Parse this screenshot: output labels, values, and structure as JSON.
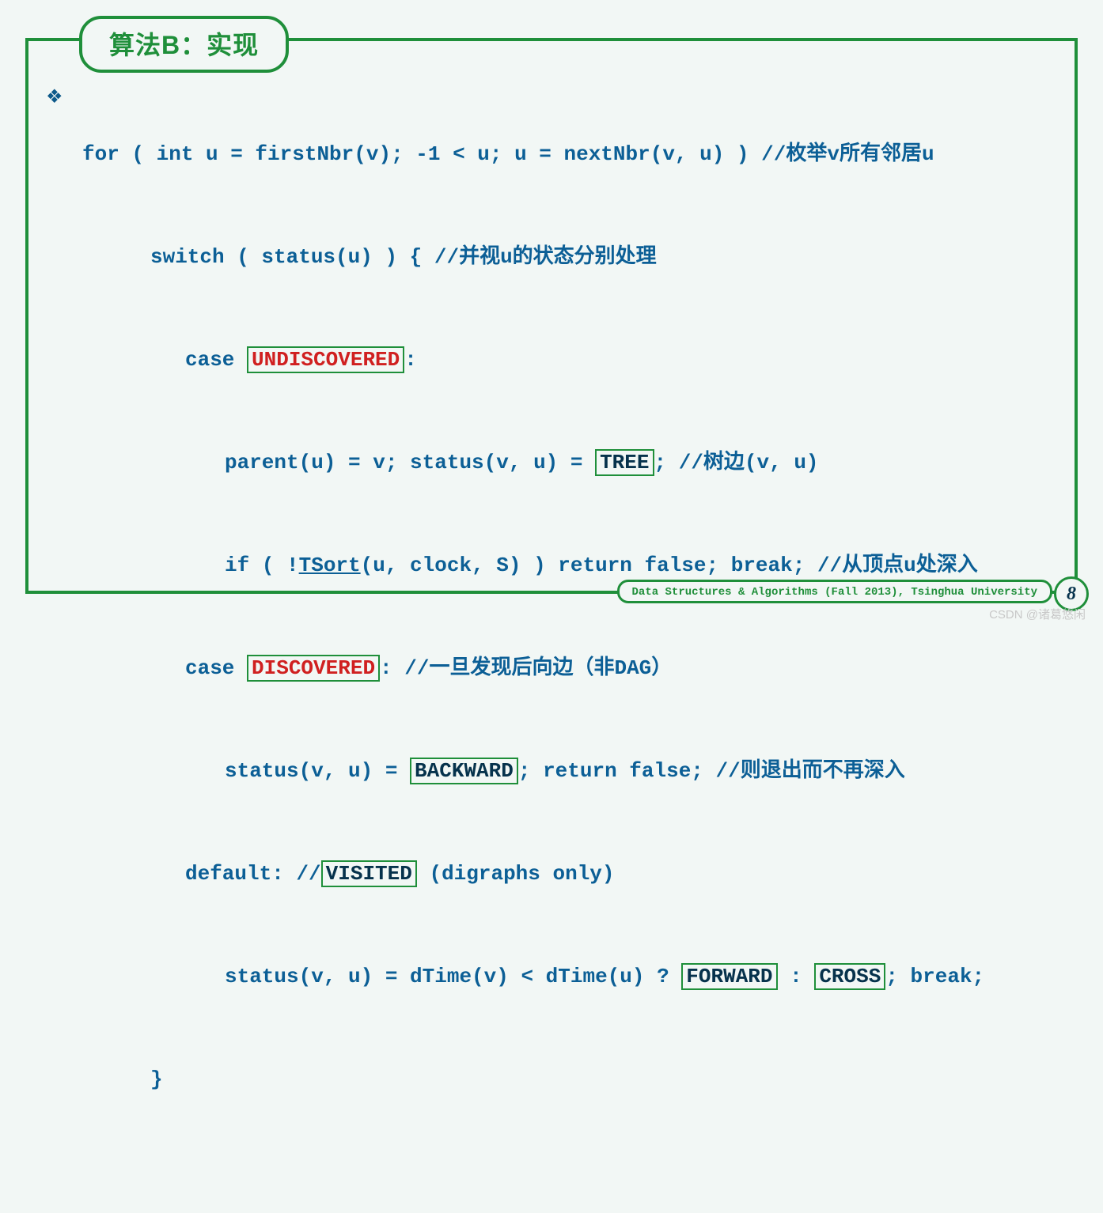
{
  "title": "算法B：实现",
  "bullet": "❖",
  "footer": "Data Structures & Algorithms (Fall 2013), Tsinghua University",
  "page": "8",
  "watermark": "CSDN @诸葛悠闲",
  "code": {
    "l1_a": "for ( int u = firstNbr(v); -1 < u; u = nextNbr(v, u) ) ",
    "l1_c": "//枚举v所有邻居u",
    "l2_a": "switch ( status(u) ) { ",
    "l2_c": "//并视u的状态分别处理",
    "l3_a": "case ",
    "l3_box": "UNDISCOVERED",
    "l3_b": ":",
    "l4_a": "parent(u) = v; status(v, u) = ",
    "l4_box": "TREE",
    "l4_b": "; ",
    "l4_c": "//树边(v, u)",
    "l5_a": "if ( !",
    "l5_u": "TSort",
    "l5_b": "(u, clock, S) ) return false; break; ",
    "l5_c": "//从顶点u处深入",
    "l6_a": "case ",
    "l6_box": "DISCOVERED",
    "l6_b": ": ",
    "l6_c": "//一旦发现后向边（非DAG）",
    "l7_a": "status(v, u) = ",
    "l7_box": "BACKWARD",
    "l7_b": "; return false; ",
    "l7_c": "//则退出而不再深入",
    "l8_a": "default: //",
    "l8_box": "VISITED",
    "l8_b": " (digraphs only)",
    "l9_a": "status(v, u) = dTime(v) < dTime(u) ? ",
    "l9_box1": "FORWARD",
    "l9_b": " : ",
    "l9_box2": "CROSS",
    "l9_c": "; break;",
    "l10": "}"
  }
}
